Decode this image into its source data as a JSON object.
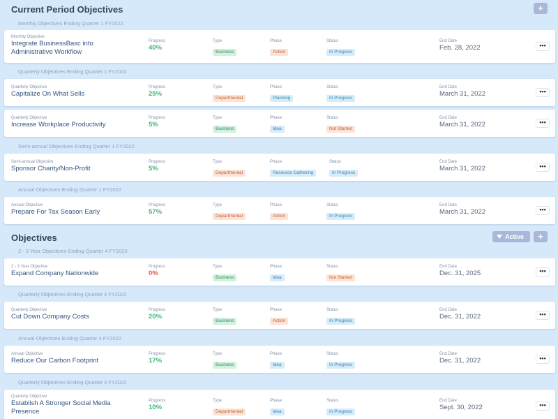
{
  "current": {
    "title": "Current Period Objectives",
    "add_label": "+",
    "groups": [
      {
        "label": "Monthly Objectives Ending Quarter 1 FY2022",
        "items": [
          {
            "category": "Monthly Objective",
            "title": "Integrate BusinessBasc into Administrative Workflow",
            "progress": "40%",
            "type": "Business",
            "phase": "Action",
            "status": "In Progress",
            "end_date": "Feb. 28, 2022"
          }
        ]
      },
      {
        "label": "Quarterly Objectives Ending Quarter 1 FY2022",
        "items": [
          {
            "category": "Quarterly Objective",
            "title": "Capitalize On What Sells",
            "progress": "25%",
            "type": "Departmental",
            "phase": "Planning",
            "status": "In Progress",
            "end_date": "March 31, 2022"
          },
          {
            "category": "Quarterly Objective",
            "title": "Increase Workplace Productivity",
            "progress": "5%",
            "type": "Business",
            "phase": "Idea",
            "status": "Not Started",
            "end_date": "March 31, 2022"
          }
        ]
      },
      {
        "label": "Semi-annual Objectives Ending Quarter 1 FY2022",
        "items": [
          {
            "category": "Semi-annual Objective",
            "title": "Sponsor Charity/Non-Profit",
            "progress": "5%",
            "type": "Departmental",
            "phase": "Resource Gathering",
            "status": "In Progress",
            "end_date": "March 31, 2022"
          }
        ]
      },
      {
        "label": "Annual Objectives Ending Quarter 1 FY2022",
        "items": [
          {
            "category": "Annual Objective",
            "title": "Prepare For Tax Season Early",
            "progress": "57%",
            "type": "Departmental",
            "phase": "Action",
            "status": "In Progress",
            "end_date": "March 31, 2022"
          }
        ]
      }
    ]
  },
  "objectives": {
    "title": "Objectives",
    "filter_label": "Active",
    "add_label": "+",
    "groups": [
      {
        "label": "2 - 3 Year Objectives Ending Quarter 4 FY2025",
        "items": [
          {
            "category": "2 - 3 Year Objective",
            "title": "Expand Company Nationwide",
            "progress": "0%",
            "type": "Business",
            "phase": "Idea",
            "status": "Not Started",
            "end_date": "Dec. 31, 2025"
          }
        ]
      },
      {
        "label": "Quarterly Objectives Ending Quarter 4 FY2022",
        "items": [
          {
            "category": "Quarterly Objective",
            "title": "Cut Down Company Costs",
            "progress": "20%",
            "type": "Business",
            "phase": "Action",
            "status": "In Progress",
            "end_date": "Dec. 31, 2022"
          }
        ]
      },
      {
        "label": "Annual Objectives Ending Quarter 4 FY2022",
        "items": [
          {
            "category": "Annual Objective",
            "title": "Reduce Our Carbon Footprint",
            "progress": "17%",
            "type": "Business",
            "phase": "Idea",
            "status": "In Progress",
            "end_date": "Dec. 31, 2022"
          }
        ]
      },
      {
        "label": "Quarterly Objectives Ending Quarter 3 FY2022",
        "items": [
          {
            "category": "Quarterly Objective",
            "title": "Establish A Stronger Social Media Presence",
            "progress": "10%",
            "type": "Departmental",
            "phase": "Idea",
            "status": "In Progress",
            "end_date": "Sept. 30, 2022"
          }
        ]
      }
    ]
  },
  "columns": {
    "progress": "Progress",
    "type": "Type",
    "phase": "Phase",
    "status": "Status",
    "end_date": "End Date"
  },
  "more_label": "•••",
  "colors": {
    "progress_positive": "#3db777",
    "progress_zero": "#e2544a",
    "background": "#d6e9fa",
    "title": "#33557f"
  }
}
